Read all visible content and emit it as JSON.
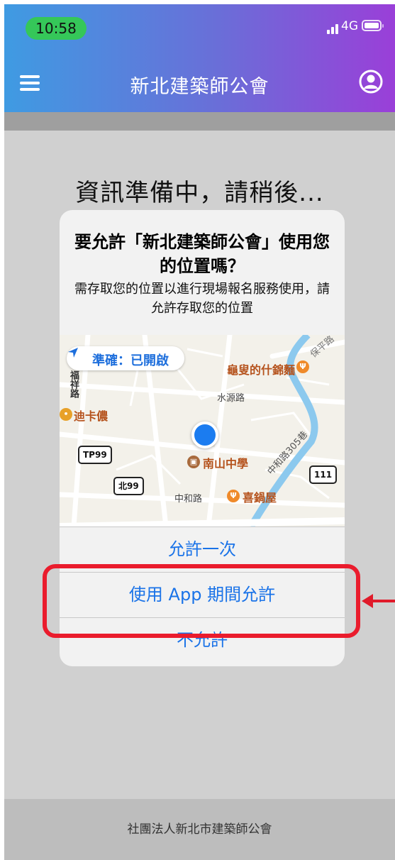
{
  "status_bar": {
    "time": "10:58",
    "network": "4G"
  },
  "nav": {
    "title": "新北建築師公會",
    "menu_icon": "hamburger-menu-icon",
    "account_icon": "user-circle-icon"
  },
  "loading_text": "資訊準備中，請稍後...",
  "dialog": {
    "title": "要允許「新北建築師公會」使用您的位置嗎？",
    "message": "需存取您的位置以進行現場報名服務使用，請允許存取您的位置",
    "precise_label": "準確：已開啟",
    "map": {
      "roads": [
        "水源路",
        "福祥路",
        "中和路",
        "中和路305巷",
        "保平路"
      ],
      "pois": [
        "龜叟的什錦麵",
        "迪卡儂",
        "南山中學",
        "喜鍋屋"
      ],
      "road_signs": [
        "TP99",
        "北99",
        "111"
      ]
    },
    "options": [
      "允許一次",
      "使用 App 期間允許",
      "不允許"
    ]
  },
  "annotation": {
    "highlight_color": "#ea1c2d"
  },
  "footer": {
    "text": "社團法人新北市建築師公會"
  },
  "colors": {
    "header_gradient_start": "#3f9be2",
    "header_gradient_end": "#9a3fd8",
    "time_pill": "#35c759",
    "ios_blue": "#1a73e8",
    "location_blue": "#1b7cf0"
  }
}
